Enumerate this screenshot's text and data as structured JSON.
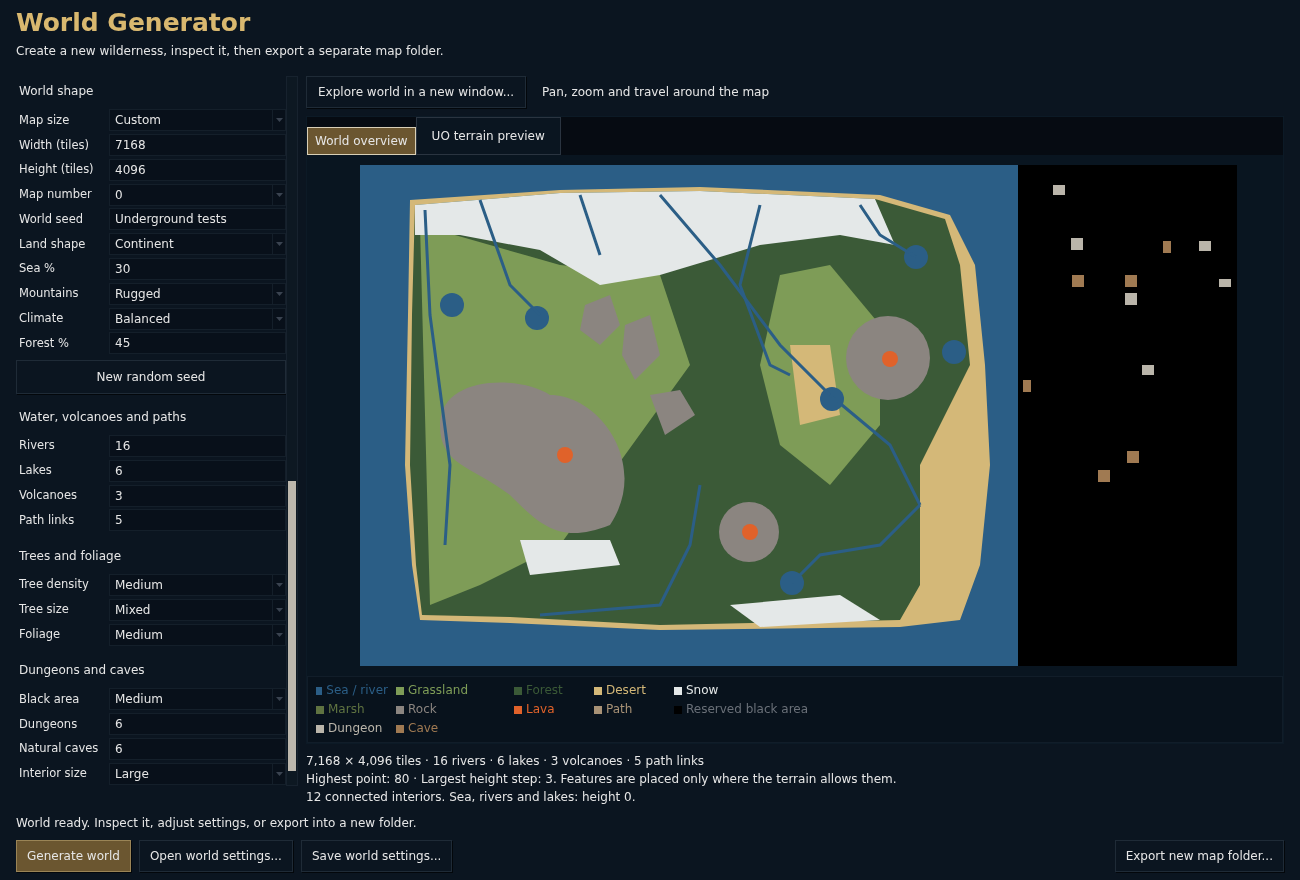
{
  "title": "World Generator",
  "subtitle": "Create a new wilderness, inspect it, then export a separate map folder.",
  "settings": [
    {
      "heading": "World shape",
      "fields": [
        {
          "label": "Map size",
          "kind": "select",
          "value": "Custom"
        },
        {
          "label": "Width (tiles)",
          "kind": "input",
          "value": "7168"
        },
        {
          "label": "Height (tiles)",
          "kind": "input",
          "value": "4096"
        },
        {
          "label": "Map number",
          "kind": "select",
          "value": "0"
        },
        {
          "label": "World seed",
          "kind": "input",
          "value": "Underground tests"
        },
        {
          "label": "Land shape",
          "kind": "select",
          "value": "Continent"
        },
        {
          "label": "Sea %",
          "kind": "input",
          "value": "30"
        },
        {
          "label": "Mountains",
          "kind": "select",
          "value": "Rugged"
        },
        {
          "label": "Climate",
          "kind": "select",
          "value": "Balanced"
        },
        {
          "label": "Forest %",
          "kind": "input",
          "value": "45"
        }
      ],
      "button": "New random seed"
    },
    {
      "heading": "Water, volcanoes and paths",
      "fields": [
        {
          "label": "Rivers",
          "kind": "input",
          "value": "16"
        },
        {
          "label": "Lakes",
          "kind": "input",
          "value": "6"
        },
        {
          "label": "Volcanoes",
          "kind": "input",
          "value": "3"
        },
        {
          "label": "Path links",
          "kind": "input",
          "value": "5"
        }
      ]
    },
    {
      "heading": "Trees and foliage",
      "fields": [
        {
          "label": "Tree density",
          "kind": "select",
          "value": "Medium"
        },
        {
          "label": "Tree size",
          "kind": "select",
          "value": "Mixed"
        },
        {
          "label": "Foliage",
          "kind": "select",
          "value": "Medium"
        }
      ]
    },
    {
      "heading": "Dungeons and caves",
      "fields": [
        {
          "label": "Black area",
          "kind": "select",
          "value": "Medium"
        },
        {
          "label": "Dungeons",
          "kind": "input",
          "value": "6"
        },
        {
          "label": "Natural caves",
          "kind": "input",
          "value": "6"
        },
        {
          "label": "Interior size",
          "kind": "select",
          "value": "Large"
        }
      ]
    }
  ],
  "explore_button": "Explore world in a new window...",
  "explore_hint": "Pan, zoom and travel around the map",
  "tabs": [
    {
      "label": "World overview",
      "selected": true
    },
    {
      "label": "UO terrain preview",
      "selected": false
    }
  ],
  "legend": [
    {
      "label": "Sea / river",
      "color": "#2b5e86"
    },
    {
      "label": "Grassland",
      "color": "#7e9c57"
    },
    {
      "label": "Forest",
      "color": "#3b5a37"
    },
    {
      "label": "Desert",
      "color": "#d4b878"
    },
    {
      "label": "Snow",
      "color": "#e4e8e8"
    },
    {
      "label": "Marsh",
      "color": "#5f7341"
    },
    {
      "label": "Rock",
      "color": "#8b8580"
    },
    {
      "label": "Lava",
      "color": "#e0622a"
    },
    {
      "label": "Path",
      "color": "#a89276"
    },
    {
      "label": "Reserved black area",
      "color": "#000000"
    },
    {
      "label": "Dungeon",
      "color": "#bab5aa"
    },
    {
      "label": "Cave",
      "color": "#a07a52"
    }
  ],
  "summary": [
    "7,168 × 4,096 tiles · 16 rivers · 6 lakes · 3 volcanoes · 5 path links",
    "Highest point: 80 · Largest height step: 3. Features are placed only where the terrain allows them.",
    "12 connected interiors. Sea, rivers and lakes: height 0."
  ],
  "status": "World ready. Inspect it, adjust settings, or export into a new folder.",
  "buttons": [
    {
      "label": "Generate world",
      "kind": "primary"
    },
    {
      "label": "Open world settings...",
      "kind": "normal"
    },
    {
      "label": "Save world settings...",
      "kind": "normal"
    }
  ],
  "export_button": "Export new map folder..."
}
